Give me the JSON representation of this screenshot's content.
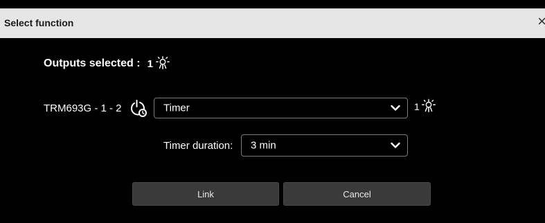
{
  "dialog": {
    "title": "Select function",
    "close_glyph": "×",
    "close_icon": "close-icon"
  },
  "outputs": {
    "label": "Outputs selected :",
    "count": "1",
    "icon": "light-icon"
  },
  "device": {
    "name": "TRM693G - 1 - 2",
    "icon": "timer-power-icon",
    "function_select": {
      "value": "Timer",
      "icon": "chevron-down-icon"
    },
    "output_count": "1",
    "output_icon": "light-icon"
  },
  "timer": {
    "label": "Timer duration:",
    "select": {
      "value": "3 min",
      "icon": "chevron-down-icon"
    }
  },
  "buttons": {
    "link": "Link",
    "cancel": "Cancel"
  },
  "colors": {
    "background": "#000000",
    "titlebar": "#e6e6e6",
    "button": "#3a3a3a",
    "select_border": "#7a7a7a",
    "text": "#ffffff"
  }
}
